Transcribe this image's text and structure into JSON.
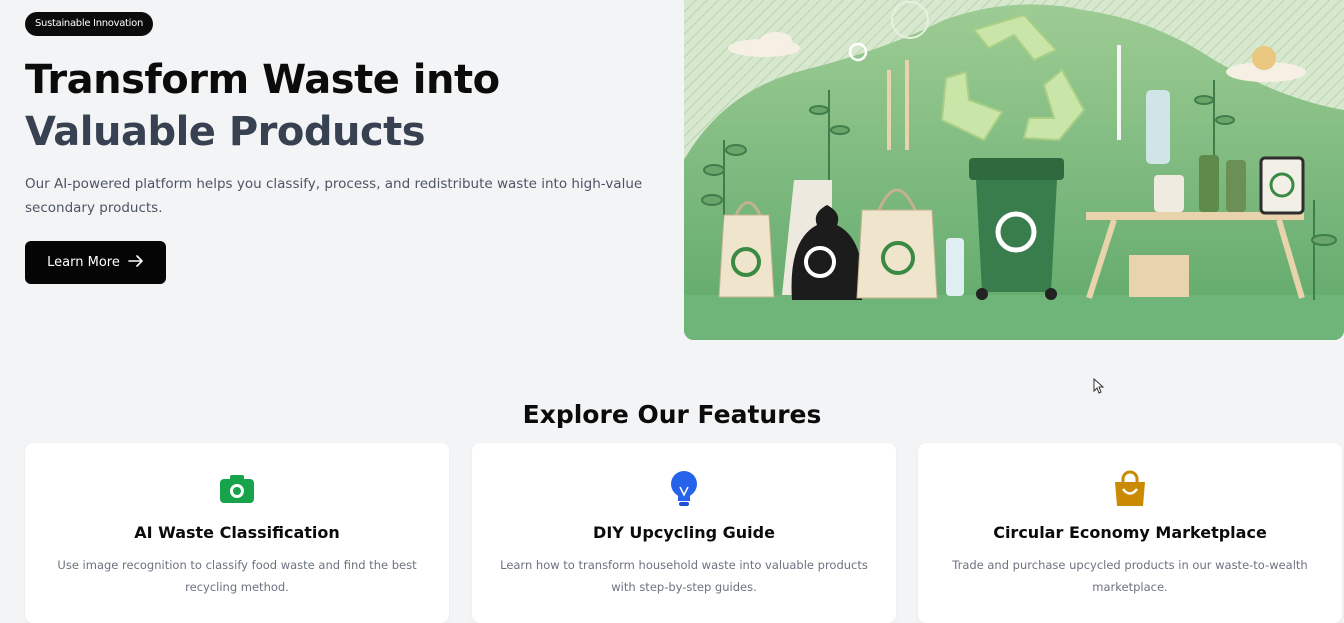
{
  "hero": {
    "badge": "Sustainable Innovation",
    "title_line1": "Transform Waste into",
    "title_line2": "Valuable Products",
    "description": "Our AI-powered platform helps you classify, process, and redistribute waste into high-value secondary products.",
    "cta_label": "Learn More",
    "cta_icon": "arrow-right-icon",
    "image": {
      "icon": "recycling-illustration",
      "theme_color": "#7fbf7f"
    }
  },
  "features": {
    "title": "Explore Our Features",
    "cards": [
      {
        "title": "AI Waste Classification",
        "description": "Use image recognition to classify food waste and find the best recycling method.",
        "icon": "camera-icon",
        "color": "#16a34a"
      },
      {
        "title": "DIY Upcycling Guide",
        "description": "Learn how to transform household waste into valuable products with step-by-step guides.",
        "icon": "lightbulb-icon",
        "color": "#2563eb"
      },
      {
        "title": "Circular Economy Marketplace",
        "description": "Trade and purchase upcycled products in our waste-to-wealth marketplace.",
        "icon": "shopping-bag-icon",
        "color": "#ca8a04"
      }
    ]
  }
}
